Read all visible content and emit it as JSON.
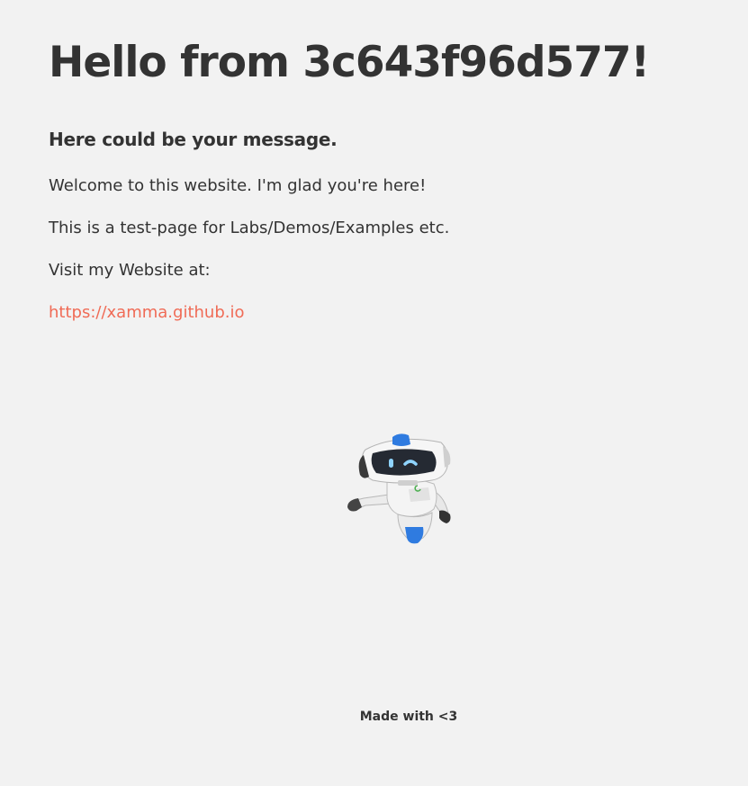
{
  "heading": {
    "title": "Hello from 3c643f96d577!",
    "subtitle": "Here could be your message."
  },
  "paragraphs": {
    "welcome": "Welcome to this website. I'm glad you're here!",
    "test_page": "This is a test-page for Labs/Demos/Examples etc.",
    "visit": "Visit my Website at:"
  },
  "link": {
    "text": "https://xamma.github.io",
    "href": "https://xamma.github.io"
  },
  "mascot": {
    "icon": "robot-icon"
  },
  "footer": {
    "text": "Made with <3"
  },
  "colors": {
    "background": "#f2f2f2",
    "text": "#333333",
    "link": "#f06b56",
    "accent_blue": "#2f7be0"
  }
}
